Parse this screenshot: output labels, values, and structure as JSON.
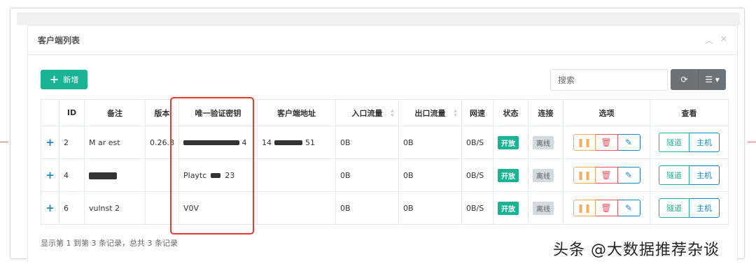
{
  "panel": {
    "title": "客户端列表"
  },
  "toolbar": {
    "add_label": "新增",
    "search_placeholder": "搜索"
  },
  "columns": [
    "",
    "ID",
    "备注",
    "版本",
    "唯一验证密钥",
    "客户端地址",
    "入口流量",
    "出口流量",
    "网速",
    "状态",
    "连接",
    "选项",
    "查看"
  ],
  "rows": [
    {
      "expand": "+",
      "id": "2",
      "remark": "M    ar   est",
      "version": "0.26.8",
      "key": "",
      "key_tail": "4",
      "addr": "14",
      "addr_tail": "51",
      "in_traffic": "0B",
      "out_traffic": "0B",
      "speed": "0B/S",
      "status": "开放",
      "conn": "离线"
    },
    {
      "expand": "+",
      "id": "4",
      "remark": "",
      "version": "",
      "key": "Playtc",
      "key_tail": "23",
      "addr": "",
      "addr_tail": "",
      "in_traffic": "0B",
      "out_traffic": "0B",
      "speed": "0B/S",
      "status": "开放",
      "conn": "离线"
    },
    {
      "expand": "+",
      "id": "6",
      "remark": "vulnst  2",
      "version": "",
      "key": "V0V",
      "key_tail": "",
      "addr": "",
      "addr_tail": "",
      "in_traffic": "0B",
      "out_traffic": "0B",
      "speed": "0B/S",
      "status": "开放",
      "conn": "离线"
    }
  ],
  "view_buttons": {
    "tunnel": "隧道",
    "host": "主机"
  },
  "footer": {
    "summary": "显示第 1 到第 3 条记录，总共 3 条记录"
  },
  "watermark": "头条 @大数据推荐杂谈",
  "icons": {
    "add": "plus-icon",
    "refresh": "refresh-icon",
    "columns": "list-icon",
    "pause": "pause-icon",
    "delete": "trash-icon",
    "edit": "edit-icon",
    "collapse": "chevron-up-icon",
    "close": "close-icon"
  },
  "colors": {
    "primary": "#1ab394",
    "info": "#1c84c6",
    "warning": "#f8ac59",
    "danger": "#ed5565",
    "highlight": "#e8392f"
  }
}
